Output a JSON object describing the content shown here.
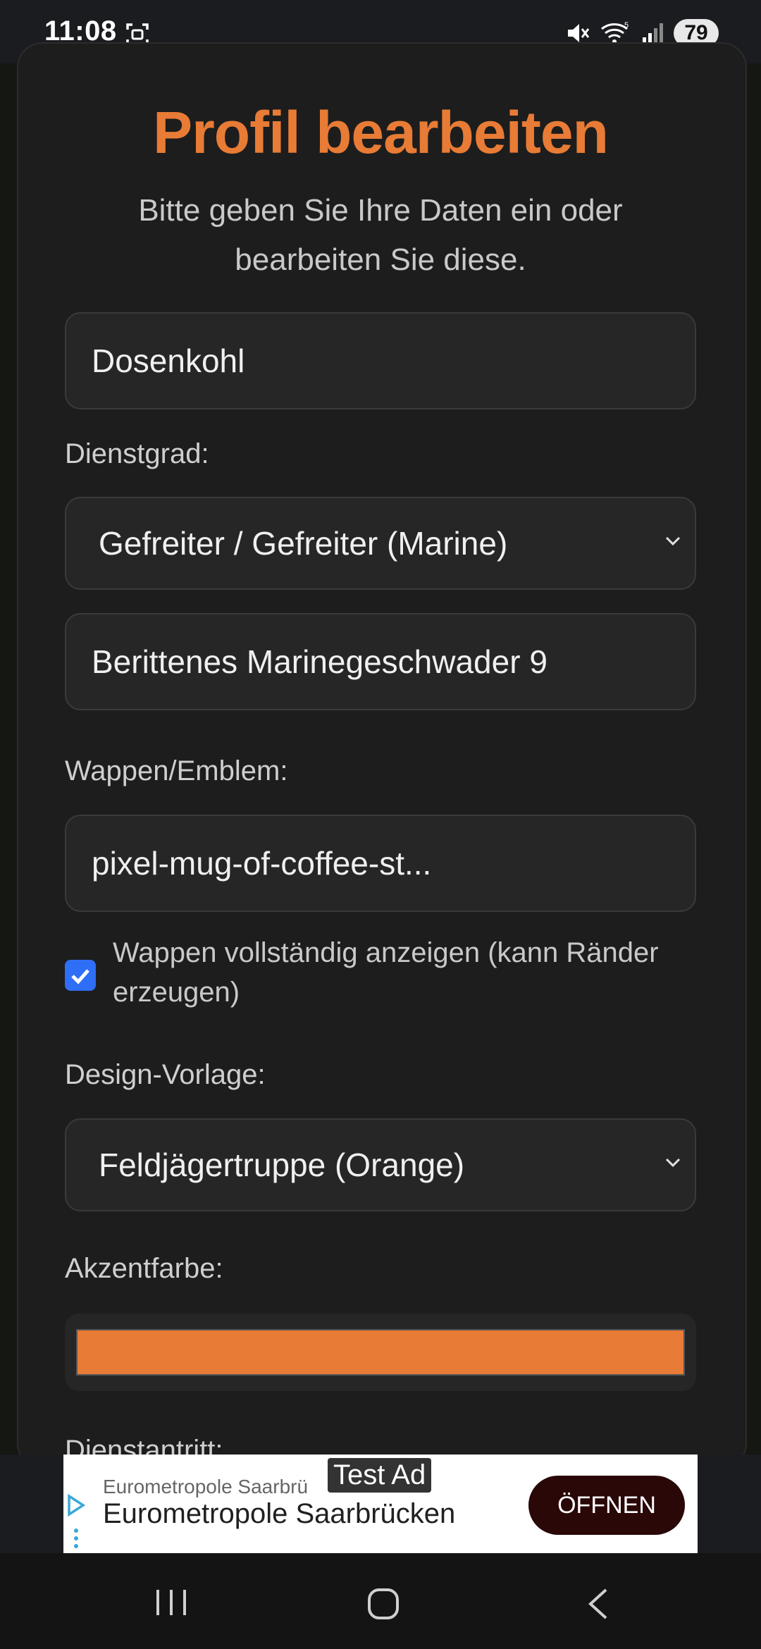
{
  "status_bar": {
    "time": "11:08",
    "battery": "79",
    "icons": [
      "screenshot-icon",
      "mute-icon",
      "wifi-icon",
      "signal-icon",
      "battery-icon"
    ]
  },
  "form": {
    "title": "Profil bearbeiten",
    "subtitle": "Bitte geben Sie Ihre Daten ein oder bearbeiten Sie diese.",
    "name_value": "Dosenkohl",
    "rank_label": "Dienstgrad:",
    "rank_value": "Gefreiter / Gefreiter (Marine)",
    "unit_value": "Berittenes Marinegeschwader 9",
    "emblem_label": "Wappen/Emblem:",
    "emblem_value": "pixel-mug-of-coffee-st...",
    "emblem_full_checked": true,
    "emblem_full_label": "Wappen vollständig anzeigen (kann Ränder erzeugen)",
    "design_label": "Design-Vorlage:",
    "design_value": "Feldjägertruppe (Orange)",
    "accent_label": "Akzentfarbe:",
    "accent_color": "#e87b35",
    "service_start_label": "Dienstantritt:"
  },
  "ad": {
    "tag": "Test Ad",
    "advertiser_small": "Eurometropole Saarbrü",
    "advertiser": "Eurometropole Saarbrücken",
    "cta": "ÖFFNEN"
  },
  "nav": {
    "icons": [
      "recents-icon",
      "home-icon",
      "back-icon"
    ]
  }
}
